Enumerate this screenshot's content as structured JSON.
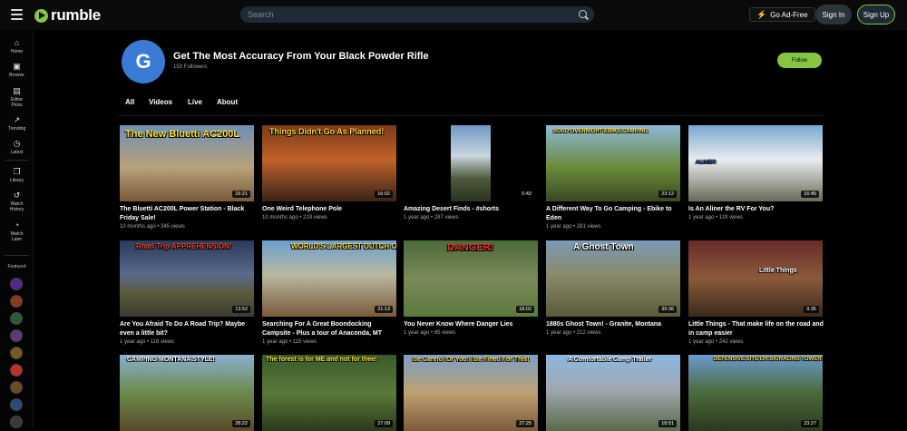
{
  "header": {
    "logo_text": "rumble",
    "search_placeholder": "Search",
    "go_ad_free": "Go Ad-Free",
    "sign_in": "Sign In",
    "sign_up": "Sign Up",
    "accent_color": "#85c742"
  },
  "sidebar": {
    "items": [
      {
        "label": "Home",
        "icon": "home-icon"
      },
      {
        "label": "Browse",
        "icon": "browse-icon"
      },
      {
        "label": "Editor Picks",
        "icon": "editor-picks-icon"
      },
      {
        "label": "Trending",
        "icon": "trending-icon"
      },
      {
        "label": "Latest",
        "icon": "clock-icon"
      },
      {
        "label": "Library",
        "icon": "library-icon"
      },
      {
        "label": "Watch History",
        "icon": "history-icon"
      },
      {
        "label": "Watch Later",
        "icon": "watch-later-icon"
      }
    ],
    "featured_label": "Featured"
  },
  "channel": {
    "avatar_letter": "G",
    "title": "Get The Most Accuracy From Your Black Powder Rifle",
    "followers": "153 Followers",
    "follow_label": "Follow"
  },
  "tabs": [
    "All",
    "Videos",
    "Live",
    "About"
  ],
  "videos": [
    {
      "title": "The Bluetti AC200L Power Station - Black Friday Sale!",
      "meta": "10 months ago • 345 views",
      "duration": "15:21",
      "caption": "The New Bluetti AC200L"
    },
    {
      "title": "One Weird Telephone Pole",
      "meta": "10 months ago • 219 views",
      "duration": "16:02",
      "caption": "Things Didn't Go As Planned!"
    },
    {
      "title": "Amazing Desert Finds - #shorts",
      "meta": "1 year ago • 287 views",
      "duration": "0:43",
      "caption": ""
    },
    {
      "title": "A Different Way To Go Camping - Ebike to Eden",
      "meta": "1 year ago • 281 views",
      "duration": "23:12",
      "caption": "SOLO OVERNIGHT EBIKE CAMPING"
    },
    {
      "title": "Is An Aliner the RV For You?",
      "meta": "1 year ago • 119 views",
      "duration": "16:45",
      "caption": "ALINER"
    },
    {
      "title": "Are You Afraid To Do A Road Trip? Maybe even a little bit?",
      "meta": "1 year ago • 118 views",
      "duration": "13:52",
      "caption": "Road Trip APPREHENSION!"
    },
    {
      "title": "Searching For A Great Boondocking Campsite - Plus a tour of Anaconda, MT",
      "meta": "1 year ago • 115 views",
      "duration": "21:13",
      "caption": "WORLD'S LARGEST DUTCH OVEN?"
    },
    {
      "title": "You Never Know Where Danger Lies",
      "meta": "1 year ago • 85 views",
      "duration": "18:02",
      "caption": "DANGER!"
    },
    {
      "title": "1880s Ghost Town! - Granite, Montana",
      "meta": "1 year ago • 212 views",
      "duration": "39:36",
      "caption": "A Ghost Town"
    },
    {
      "title": "Little Things - That make life on the road and in camp easier",
      "meta": "1 year ago • 242 views",
      "duration": "9:35",
      "caption": "Little Things"
    },
    {
      "title": "",
      "meta": "",
      "duration": "28:22",
      "caption": "CAMPING MONTANA STYLE!"
    },
    {
      "title": "",
      "meta": "",
      "duration": "27:09",
      "caption": "The forest is for ME and not for thee!"
    },
    {
      "title": "",
      "meta": "",
      "duration": "27:25",
      "caption": "Be Careful Or You'll Be Fined For This!"
    },
    {
      "title": "",
      "meta": "",
      "duration": "18:51",
      "caption": "A Comfortable Camp Trailer"
    },
    {
      "title": "",
      "meta": "",
      "duration": "23:27",
      "caption": "DEFENSIVE SITE OR SIGNALING TOWER?"
    }
  ]
}
